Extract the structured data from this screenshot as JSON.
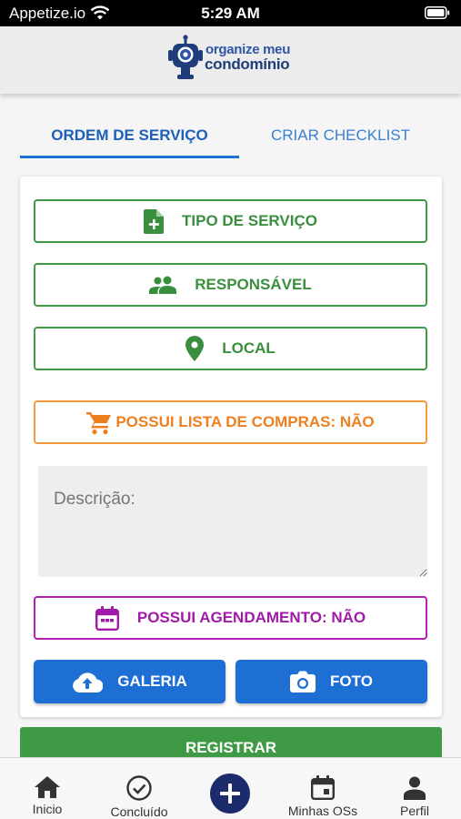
{
  "status_bar": {
    "carrier": "Appetize.io",
    "time": "5:29 AM"
  },
  "header": {
    "logo_line1": "organize meu",
    "logo_line2": "condomínio"
  },
  "tabs": [
    {
      "label": "ORDEM DE SERVIÇO",
      "active": true
    },
    {
      "label": "CRIAR CHECKLIST",
      "active": false
    }
  ],
  "form": {
    "tipo_servico_label": "TIPO DE SERVIÇO",
    "responsavel_label": "RESPONSÁVEL",
    "local_label": "LOCAL",
    "lista_compras_label": "POSSUI LISTA DE COMPRAS: NÃO",
    "descricao_placeholder": "Descrição:",
    "agendamento_label": "POSSUI AGENDAMENTO: NÃO",
    "galeria_label": "GALERIA",
    "foto_label": "FOTO"
  },
  "registrar_label": "REGISTRAR",
  "bottom_nav": {
    "inicio": "Inicio",
    "concluido": "Concluído",
    "minhas_oss": "Minhas OSs",
    "perfil": "Perfil"
  },
  "icons": {
    "tipo_servico": "note-add-icon",
    "responsavel": "people-icon",
    "local": "location-pin-icon",
    "lista_compras": "shopping-cart-icon",
    "agendamento": "calendar-icon",
    "galeria": "cloud-upload-icon",
    "foto": "camera-icon",
    "inicio": "home-icon",
    "concluido": "check-circle-icon",
    "add": "plus-icon",
    "minhas_oss": "calendar-icon",
    "perfil": "person-icon"
  },
  "colors": {
    "primary_blue": "#1e6fd4",
    "green": "#3e9a46",
    "orange": "#f39a3d",
    "purple": "#b022b6",
    "navy": "#1c2b6b"
  }
}
